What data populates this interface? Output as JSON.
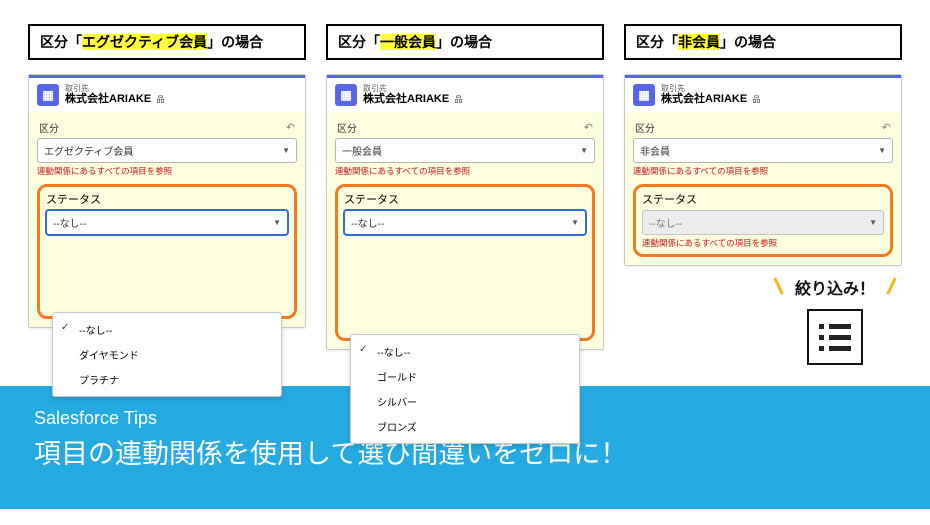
{
  "titles": {
    "a_pre": "区分「",
    "a_hl": "エグゼクティブ会員",
    "a_post": "」の場合",
    "b_pre": "区分「",
    "b_hl": "一般会員",
    "b_post": "」の場合",
    "c_pre": "区分「",
    "c_hl": "非会員",
    "c_post": "」の場合"
  },
  "acct": {
    "label": "取引先",
    "name": "株式会社ARIAKE"
  },
  "field_kubun": "区分",
  "field_status": "ステータス",
  "help": "連動関係にあるすべての項目を参照",
  "vals": {
    "a_kubun": "エグゼクティブ会員",
    "b_kubun": "一般会員",
    "c_kubun": "非会員",
    "none": "--なし--"
  },
  "opts": {
    "a": [
      "--なし--",
      "ダイヤモンド",
      "プラチナ"
    ],
    "b": [
      "--なし--",
      "ゴールド",
      "シルバー",
      "ブロンズ"
    ]
  },
  "callout": "絞り込み！",
  "banner": {
    "sub": "Salesforce Tips",
    "title": "項目の連動関係を使用して選び間違いをゼロに！"
  }
}
